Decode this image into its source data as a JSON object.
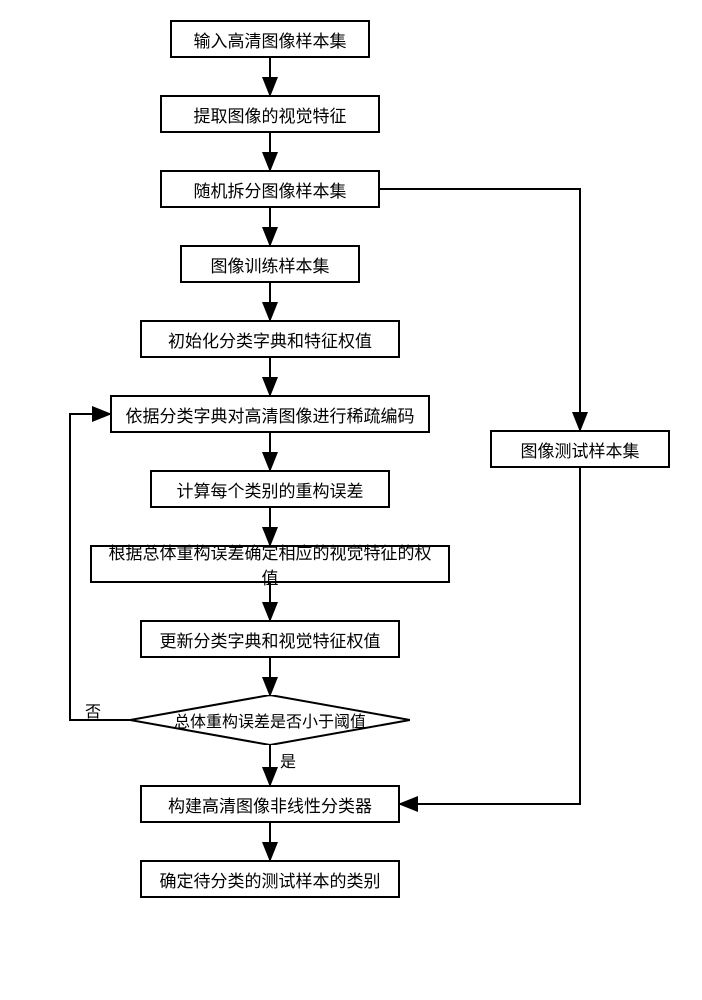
{
  "chart_data": {
    "type": "flowchart",
    "title": "",
    "nodes": [
      {
        "id": "n1",
        "type": "process",
        "label": "输入高清图像样本集"
      },
      {
        "id": "n2",
        "type": "process",
        "label": "提取图像的视觉特征"
      },
      {
        "id": "n3",
        "type": "process",
        "label": "随机拆分图像样本集"
      },
      {
        "id": "n4",
        "type": "process",
        "label": "图像训练样本集"
      },
      {
        "id": "n5",
        "type": "process",
        "label": "初始化分类字典和特征权值"
      },
      {
        "id": "n6",
        "type": "process",
        "label": "依据分类字典对高清图像进行稀疏编码"
      },
      {
        "id": "n7",
        "type": "process",
        "label": "计算每个类别的重构误差"
      },
      {
        "id": "n8",
        "type": "process",
        "label": "根据总体重构误差确定相应的视觉特征的权值"
      },
      {
        "id": "n9",
        "type": "process",
        "label": "更新分类字典和视觉特征权值"
      },
      {
        "id": "n10",
        "type": "decision",
        "label": "总体重构误差是否小于阈值"
      },
      {
        "id": "n11",
        "type": "process",
        "label": "构建高清图像非线性分类器"
      },
      {
        "id": "n12",
        "type": "process",
        "label": "确定待分类的测试样本的类别"
      },
      {
        "id": "n13",
        "type": "process",
        "label": "图像测试样本集"
      }
    ],
    "edges": [
      {
        "from": "n1",
        "to": "n2"
      },
      {
        "from": "n2",
        "to": "n3"
      },
      {
        "from": "n3",
        "to": "n4"
      },
      {
        "from": "n3",
        "to": "n13"
      },
      {
        "from": "n4",
        "to": "n5"
      },
      {
        "from": "n5",
        "to": "n6"
      },
      {
        "from": "n6",
        "to": "n7"
      },
      {
        "from": "n7",
        "to": "n8"
      },
      {
        "from": "n8",
        "to": "n9"
      },
      {
        "from": "n9",
        "to": "n10"
      },
      {
        "from": "n10",
        "to": "n11",
        "label": "是"
      },
      {
        "from": "n10",
        "to": "n6",
        "label": "否"
      },
      {
        "from": "n13",
        "to": "n11"
      },
      {
        "from": "n11",
        "to": "n12"
      }
    ],
    "labels": {
      "yes": "是",
      "no": "否"
    }
  }
}
